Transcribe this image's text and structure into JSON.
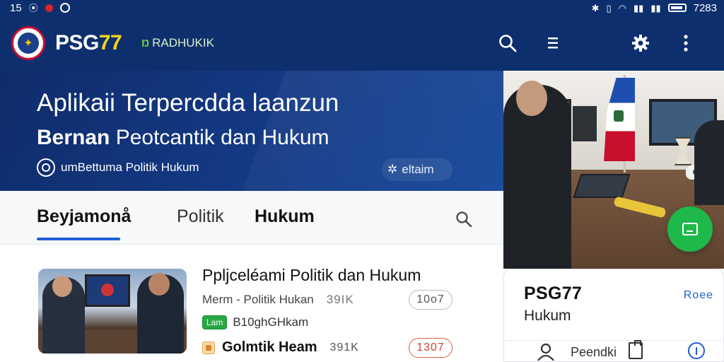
{
  "status_bar": {
    "time": "15",
    "clock": "7283"
  },
  "app_bar": {
    "brand_main": "PSG",
    "brand_accent": "77",
    "tagline_icon": "Ŋ",
    "tagline": "RADHUKIK",
    "actions": [
      "search-icon",
      "menu-icon",
      "gear-icon",
      "overflow-icon"
    ]
  },
  "hero": {
    "title": "Aplikaii Terpercdda laanzun",
    "subtitle_bold": "Bernan",
    "subtitle_rest": "Peotcantik dan Hukum",
    "chip_label": "umBettuma Politik Hukum",
    "pill_label": "eltaim"
  },
  "tabs": {
    "items": [
      "Beyjamonå",
      "Politik",
      "Hukum"
    ],
    "active_index": 0
  },
  "list": {
    "item1": {
      "title": "Ppljceléami Politik dan Hukum",
      "meta_text": "Merm - Politik Hukan",
      "meta_count": "39IK",
      "pill": "10o7",
      "badge": "Lam",
      "badge_text": "B10ghGHkam"
    },
    "item2": {
      "title": "Golmtik Heam",
      "count": "391K",
      "pill": "1307"
    }
  },
  "side_card": {
    "title": "PSG77",
    "subtitle": "Hukum",
    "link": "Roee",
    "footer_label": "Peendki"
  },
  "photo": {
    "badge": "Gs"
  },
  "colors": {
    "navy": "#0d2f6e",
    "brand_yellow": "#f7d21c",
    "accent_blue": "#1f5fd6",
    "fab_green": "#1fb84b",
    "alert_red": "#d0432d"
  }
}
